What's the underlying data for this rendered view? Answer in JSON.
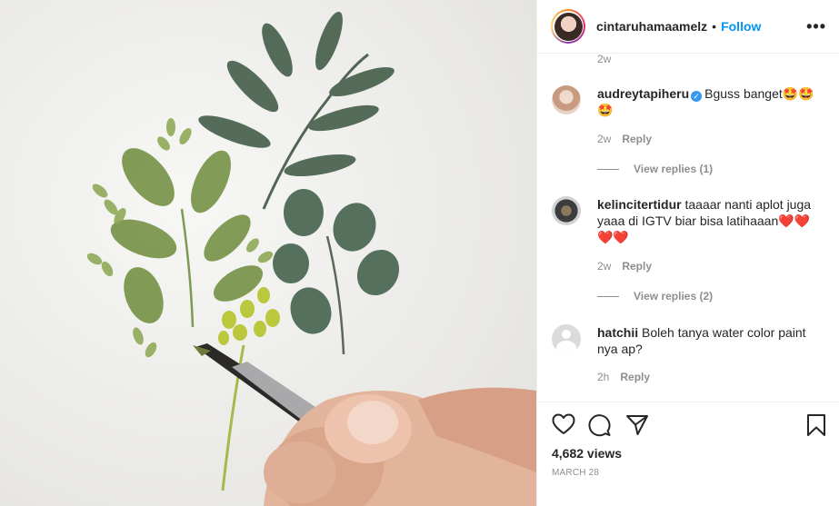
{
  "header": {
    "username": "cintaruhamaamelz",
    "separator": "•",
    "follow_label": "Follow",
    "more_label": "•••"
  },
  "comments_cutoff_time": "2w",
  "comments": [
    {
      "username": "audreytapiheru",
      "verified": true,
      "text": "Bguss banget🤩🤩🤩",
      "time": "2w",
      "reply_label": "Reply",
      "view_replies": "View replies (1)"
    },
    {
      "username": "kelincitertidur",
      "verified": false,
      "text": "taaaar nanti aplot juga yaaa di IGTV biar bisa latihaaan❤️❤️❤️❤️",
      "time": "2w",
      "reply_label": "Reply",
      "view_replies": "View replies (2)"
    },
    {
      "username": "hatchii",
      "verified": false,
      "text": "Boleh tanya water color paint nya ap?",
      "time": "2h",
      "reply_label": "Reply"
    }
  ],
  "actions": {
    "like_icon": "heart-icon",
    "comment_icon": "comment-icon",
    "share_icon": "share-icon",
    "save_icon": "bookmark-icon"
  },
  "views": "4,682 views",
  "date": "MARCH 28",
  "colors": {
    "link": "#0095f6",
    "secondary_text": "#8e8e8e",
    "verified": "#3897f0",
    "border": "#efefef"
  }
}
